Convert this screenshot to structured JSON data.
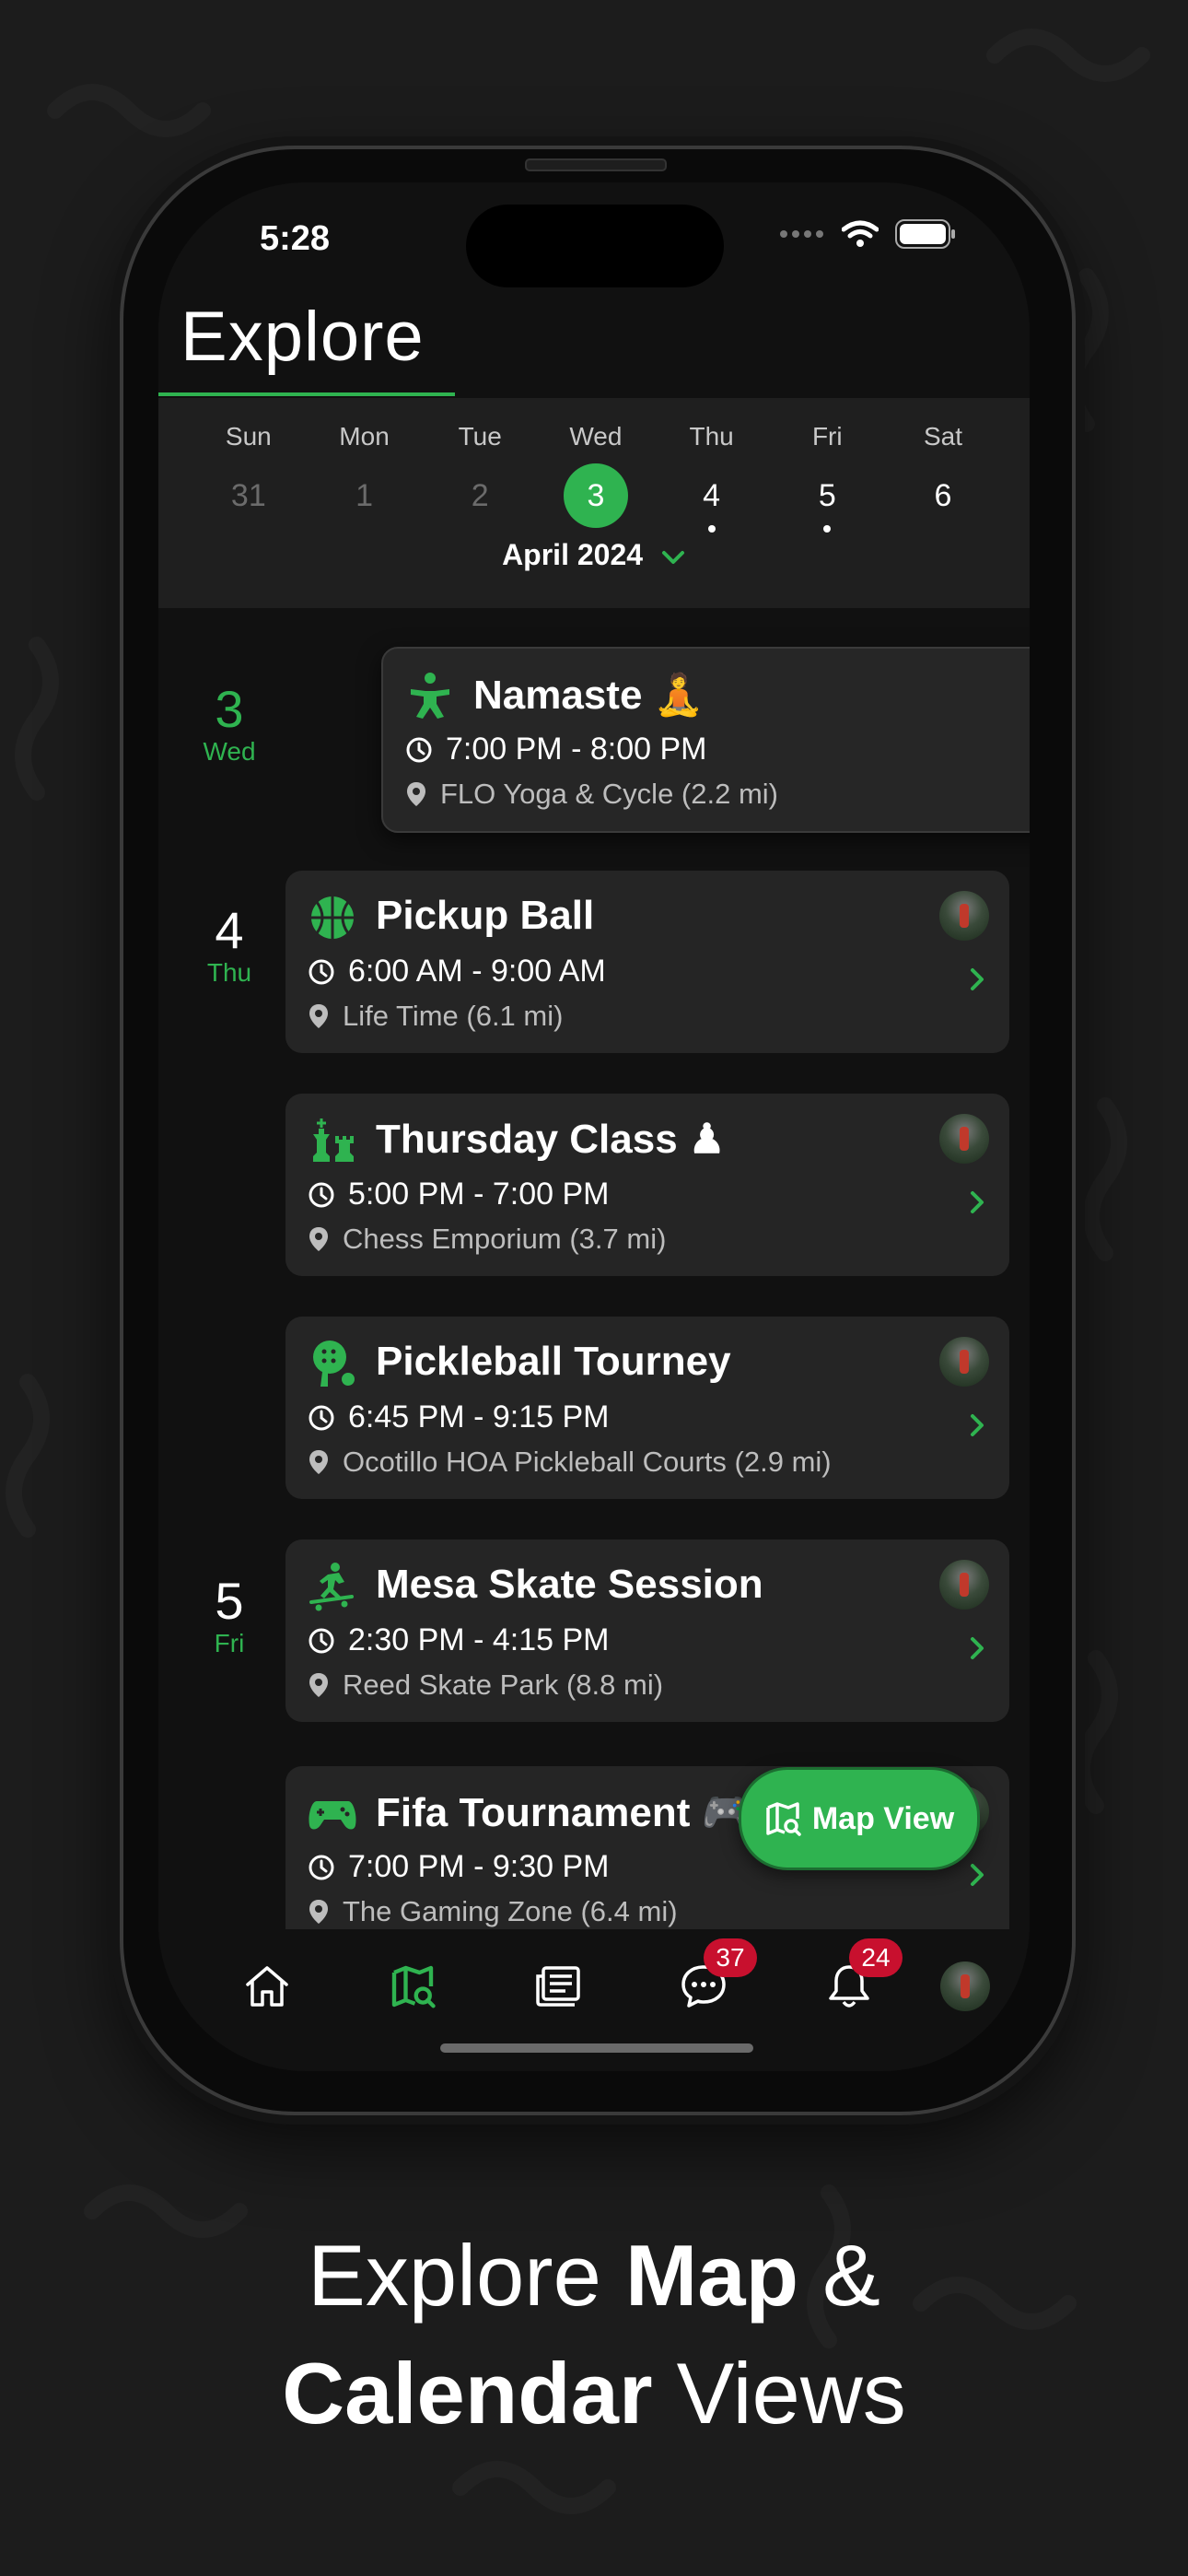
{
  "colors": {
    "accent": "#2fb350",
    "badge": "#c8102e",
    "card": "#252525",
    "background": "#1c1c1c"
  },
  "status_bar": {
    "time": "5:28"
  },
  "header": {
    "title": "Explore"
  },
  "calendar": {
    "days": [
      {
        "name": "Sun",
        "date": "31",
        "state": "past",
        "has_events": false
      },
      {
        "name": "Mon",
        "date": "1",
        "state": "past",
        "has_events": false
      },
      {
        "name": "Tue",
        "date": "2",
        "state": "past",
        "has_events": false
      },
      {
        "name": "Wed",
        "date": "3",
        "state": "selected",
        "has_events": true
      },
      {
        "name": "Thu",
        "date": "4",
        "state": "future",
        "has_events": true
      },
      {
        "name": "Fri",
        "date": "5",
        "state": "future",
        "has_events": true
      },
      {
        "name": "Sat",
        "date": "6",
        "state": "future",
        "has_events": false
      }
    ],
    "month": "April 2024"
  },
  "day_groups": [
    {
      "date": "3",
      "day": "Wed"
    },
    {
      "date": "4",
      "day": "Thu"
    },
    {
      "date": "5",
      "day": "Fri"
    }
  ],
  "events": [
    {
      "title": "Namaste 🧘",
      "time": "7:00 PM - 8:00 PM",
      "location": "FLO Yoga & Cycle (2.2 mi)",
      "icon": "yoga-icon"
    },
    {
      "title": "Pickup Ball",
      "time": "6:00 AM - 9:00 AM",
      "location": "Life Time (6.1 mi)",
      "icon": "basketball-icon"
    },
    {
      "title": "Thursday Class ♟",
      "time": "5:00 PM - 7:00 PM",
      "location": "Chess Emporium (3.7 mi)",
      "icon": "chess-icon"
    },
    {
      "title": "Pickleball Tourney",
      "time": "6:45 PM - 9:15 PM",
      "location": "Ocotillo HOA Pickleball Courts (2.9 mi)",
      "icon": "pickleball-icon"
    },
    {
      "title": "Mesa Skate Session",
      "time": "2:30 PM - 4:15 PM",
      "location": "Reed Skate Park (8.8 mi)",
      "icon": "skateboard-icon"
    },
    {
      "title": "Fifa Tournament 🎮",
      "time": "7:00 PM - 9:30 PM",
      "location": "The Gaming Zone (6.4 mi)",
      "icon": "gamepad-icon"
    }
  ],
  "map_button": {
    "label": "Map View",
    "icon": "map-search-icon"
  },
  "tabbar": {
    "items": [
      {
        "name": "home",
        "icon": "home-icon"
      },
      {
        "name": "explore",
        "icon": "map-search-icon",
        "active": true
      },
      {
        "name": "feed",
        "icon": "feed-icon"
      },
      {
        "name": "messages",
        "icon": "chat-icon",
        "badge": "37"
      },
      {
        "name": "notifications",
        "icon": "bell-icon",
        "badge": "24"
      },
      {
        "name": "profile",
        "icon": "avatar"
      }
    ]
  },
  "headline": {
    "line1_light": "Explore ",
    "line1_bold": "Map",
    "line1_end": " &",
    "line2_bold": "Calendar",
    "line2_light": " Views"
  }
}
